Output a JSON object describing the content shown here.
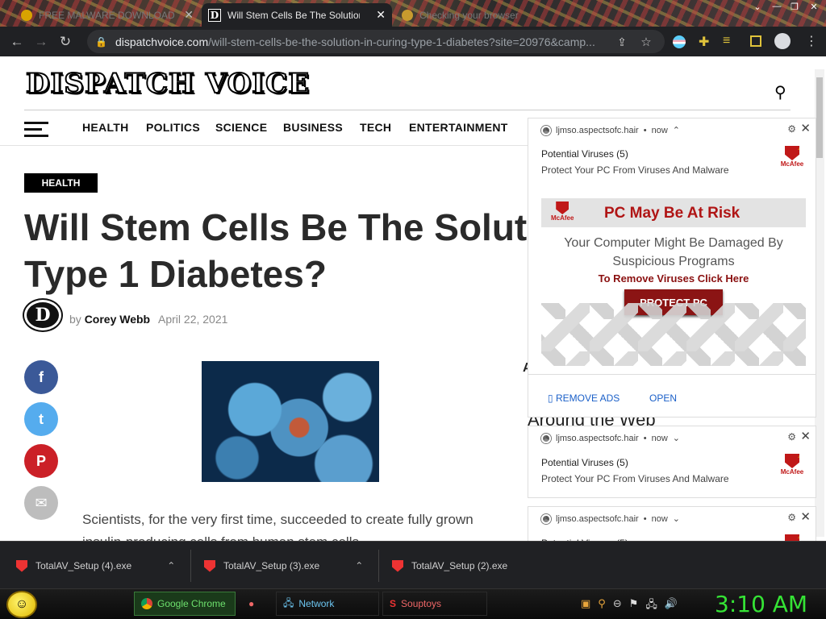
{
  "tabs": [
    {
      "title": "FREE MALWARE DOWNLOAD",
      "active": false
    },
    {
      "title": "Will Stem Cells Be The Solution I",
      "active": true
    },
    {
      "title": "Checking your browser",
      "active": false
    }
  ],
  "url": {
    "host": "dispatchvoice.com",
    "path": "/will-stem-cells-be-the-solution-in-curing-type-1-diabetes?site=20976&camp..."
  },
  "site": {
    "logo": "DISPATCH VOICE",
    "nav": [
      "HEALTH",
      "POLITICS",
      "SCIENCE",
      "BUSINESS",
      "TECH",
      "ENTERTAINMENT"
    ],
    "category": "HEALTH",
    "headline_line1": "Will Stem Cells Be The Solut",
    "headline_line2": "Type 1 Diabetes?",
    "author_prefix": "by",
    "author": "Corey Webb",
    "date": "April 22, 2021",
    "body_line1": "Scientists, for the very first time, succeeded to create fully grown",
    "body_line2": "insulin-producing cells from human stem cells.",
    "sidebar_heading": "Around the Web",
    "sidebar_letter": "A"
  },
  "notifications": {
    "origin": "ljmso.aspectsofc.hair",
    "time": "now",
    "title": "Potential Viruses (5)",
    "body": "Protect Your PC From Viruses And Malware",
    "brand": "McAfee",
    "banner_title": "PC May Be At Risk",
    "banner_line1": "Your Computer Might Be Damaged By",
    "banner_line2": "Suspicious Programs",
    "banner_cta": "To Remove Viruses Click Here",
    "banner_button": "PROTECT PC",
    "remove_ads": "REMOVE ADS",
    "open": "OPEN"
  },
  "downloads": [
    "TotalAV_Setup (4).exe",
    "TotalAV_Setup (3).exe",
    "TotalAV_Setup (2).exe"
  ],
  "taskbar": {
    "items": [
      "Google Chrome",
      "Network",
      "Souptoys"
    ],
    "clock": "3:10 AM"
  },
  "colors": {
    "facebook": "#3b5998",
    "twitter": "#55acee",
    "pinterest": "#cb2027",
    "email": "#bdbdbd",
    "mcafee": "#c01818",
    "clock": "#35e335"
  }
}
